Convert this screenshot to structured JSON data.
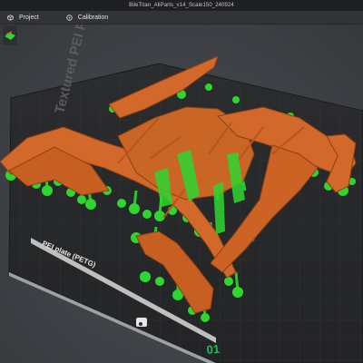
{
  "window": {
    "title": "BileTitan_AllParts_v14_Scale150_240924"
  },
  "tabs": [
    {
      "label": "Project",
      "icon": "cube-icon",
      "active": true
    },
    {
      "label": "Calibration",
      "icon": "gauge-icon",
      "active": false
    }
  ],
  "plate": {
    "back_label": "Textured PEI Plate",
    "front_label": "PEI plate (PETG)",
    "plate_number": "01"
  },
  "colors": {
    "model": "#d2692a",
    "support": "#2fd62f",
    "plate": "#2a2b2d",
    "accent": "#00c24a"
  }
}
